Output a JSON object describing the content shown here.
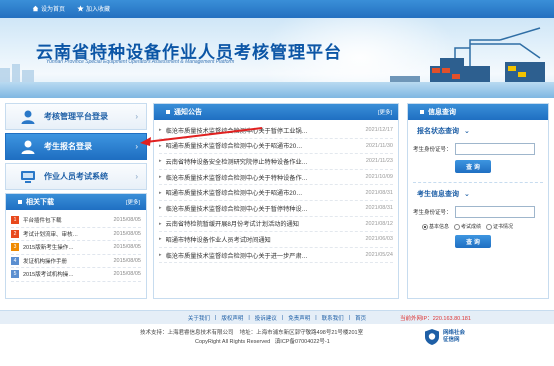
{
  "topbar": {
    "set_home": "设为首页",
    "add_favorite": "加入收藏"
  },
  "banner": {
    "title": "云南省特种设备作业人员考核管理平台",
    "subtitle": "Yunnan Province Special Equipment Operators Assessment & Management Platform"
  },
  "sidebar": {
    "items": [
      {
        "label": "考核管理平台登录",
        "icon": "user-icon"
      },
      {
        "label": "考生报名登录",
        "icon": "user-icon"
      },
      {
        "label": "作业人员考试系统",
        "icon": "computer-icon"
      }
    ]
  },
  "downloads": {
    "title": "相关下载",
    "more": "[更多]",
    "items": [
      {
        "num": "1",
        "title": "平台插件包下载",
        "date": "2015/08/05",
        "color": "#e8491d"
      },
      {
        "num": "2",
        "title": "考试计划流审、审核…",
        "date": "2015/08/05",
        "color": "#e8491d"
      },
      {
        "num": "3",
        "title": "2015版新考生操作…",
        "date": "2015/08/05",
        "color": "#f08a00"
      },
      {
        "num": "4",
        "title": "发证机构操作手册",
        "date": "2015/08/05",
        "color": "#5b8fd0"
      },
      {
        "num": "5",
        "title": "2015版考试机构操…",
        "date": "2015/08/05",
        "color": "#5b8fd0"
      }
    ]
  },
  "notices": {
    "title": "通知公告",
    "more": "[更多]",
    "items": [
      {
        "title": "临沧市质量技术监督综合检测中心关于暂停工业锅…",
        "date": "2021/12/17"
      },
      {
        "title": "昭通市质量技术监督综合检测中心关于昭通市20…",
        "date": "2021/11/30"
      },
      {
        "title": "云南省特种设备安全检测研究院停止特种设备作业…",
        "date": "2021/11/23"
      },
      {
        "title": "临沧市质量技术监督综合检测中心关于特种设备作…",
        "date": "2021/10/09"
      },
      {
        "title": "昭通市质量技术监督综合检测中心关于昭通市20…",
        "date": "2021/08/31"
      },
      {
        "title": "临沧市质量技术监督综合检测中心关于暂停特种设…",
        "date": "2021/08/31"
      },
      {
        "title": "云南省特检院暂缓开展8月份考试计划活动的通知",
        "date": "2021/08/12"
      },
      {
        "title": "昭通市特种设备作业人员考试时间通知",
        "date": "2021/06/03"
      },
      {
        "title": "临沧市质量技术监督综合检测中心关于进一步严肃…",
        "date": "2021/05/24"
      }
    ]
  },
  "query": {
    "title": "信息查询",
    "section1_title": "报名状态查询",
    "section2_title": "考生信息查询",
    "id_label": "考生身份证号：",
    "button": "查 询",
    "radios": [
      "基本信息",
      "考试成绩",
      "证书情况"
    ]
  },
  "footer": {
    "links": [
      "关于我们",
      "版权声明",
      "投诉建议",
      "免责声明",
      "联系我们",
      "首页"
    ],
    "separator": "|",
    "ip": "当前外网IP：220.163.80.181",
    "support": "技术支持：上海君睿信息技术有限公司",
    "address": "地址：上海市浦东新区郭守敬路498号21号楼201室",
    "rights": "CopyRight All Rights Reserved",
    "icp": "滇ICP备07004022号-1",
    "badge_line1": "网络社会",
    "badge_line2": "征信网"
  },
  "colors": {
    "primary": "#1f6fc2",
    "accent_red": "#d33"
  }
}
